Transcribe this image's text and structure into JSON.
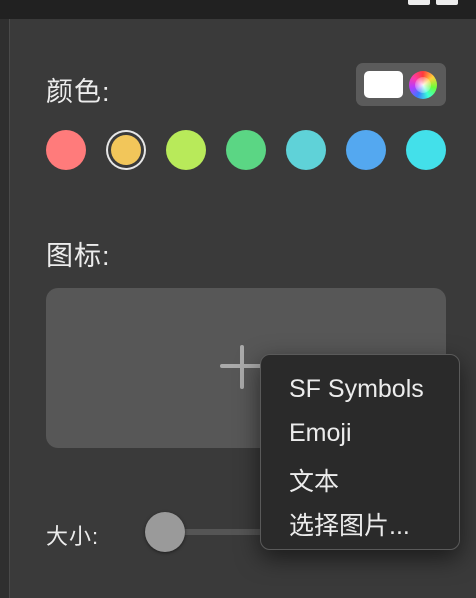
{
  "colors_section": {
    "label": "颜色:",
    "toggle": {
      "swatch": "white-swatch",
      "picker": "color-wheel-icon"
    },
    "swatches": [
      {
        "name": "red",
        "hex": "#ff7b7b"
      },
      {
        "name": "yellow",
        "hex": "#f2c65a",
        "selected": true
      },
      {
        "name": "lime",
        "hex": "#b8ea5a"
      },
      {
        "name": "green",
        "hex": "#5bd684"
      },
      {
        "name": "teal",
        "hex": "#5fd2d8"
      },
      {
        "name": "blue",
        "hex": "#54a8f0"
      },
      {
        "name": "cyan",
        "hex": "#43e0ea"
      }
    ]
  },
  "icon_section": {
    "label": "图标:",
    "add_icon": "plus-icon"
  },
  "size_section": {
    "label": "大小:"
  },
  "context_menu": {
    "items": [
      "SF Symbols",
      "Emoji",
      "文本",
      "选择图片..."
    ]
  }
}
